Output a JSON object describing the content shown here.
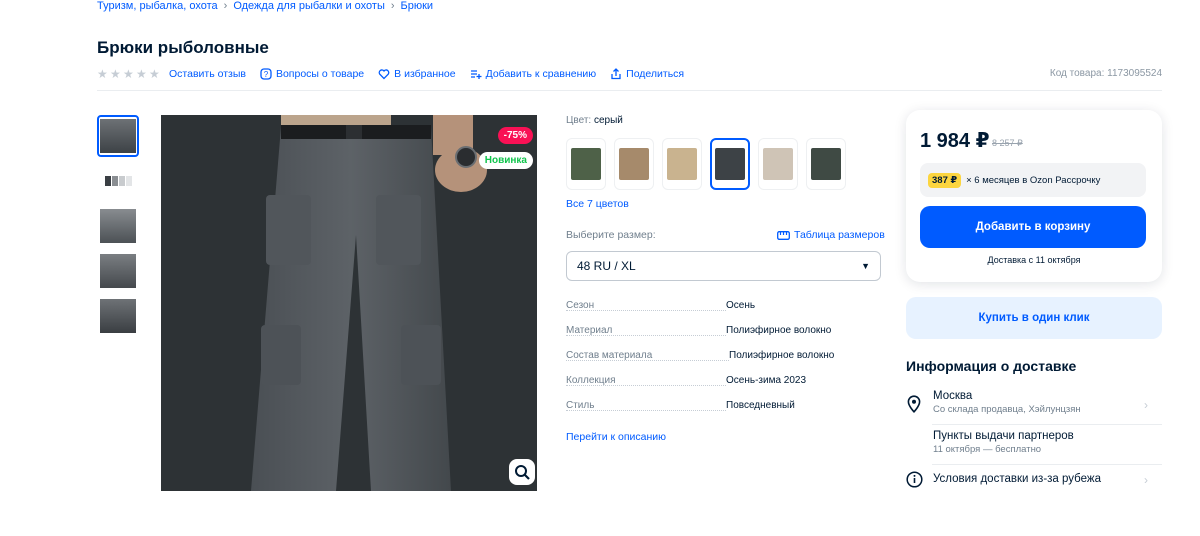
{
  "breadcrumb": [
    "Туризм, рыбалка, охота",
    "Одежда для рыбалки и охоты",
    "Брюки"
  ],
  "title": "Брюки рыболовные",
  "actions": {
    "review": "Оставить отзыв",
    "questions": "Вопросы о товаре",
    "favorite": "В избранное",
    "compare": "Добавить к сравнению",
    "share": "Поделиться"
  },
  "product_code": "Код товара: 1173095524",
  "badges": {
    "discount": "-75%",
    "new": "Новинка"
  },
  "color": {
    "label": "Цвет:",
    "value": "серый",
    "all_colors": "Все 7 цветов"
  },
  "size": {
    "label": "Выберите размер:",
    "table_link": "Таблица размеров",
    "selected": "48 RU / XL"
  },
  "properties": [
    {
      "key": "Сезон",
      "value": "Осень"
    },
    {
      "key": "Материал",
      "value": "Полиэфирное волокно"
    },
    {
      "key": "Состав материала",
      "value": "Полиэфирное волокно"
    },
    {
      "key": "Коллекция",
      "value": "Осень-зима 2023"
    },
    {
      "key": "Стиль",
      "value": "Повседневный"
    }
  ],
  "to_description": "Перейти к описанию",
  "price": {
    "current": "1 984 ₽",
    "old": "8 257 ₽",
    "installment_amount": "387 ₽",
    "installment_text": "× 6 месяцев в Ozon Рассрочку",
    "add_to_cart": "Добавить в корзину",
    "delivery": "Доставка с 11 октября"
  },
  "buy_one_click": "Купить в один клик",
  "delivery_info": {
    "heading": "Информация о доставке",
    "city": "Москва",
    "city_sub": "Со склада продавца, Хэйлунцзян",
    "pickup": "Пункты выдачи партнеров",
    "pickup_sub": "11 октября — бесплатно",
    "abroad": "Условия доставки из-за рубежа"
  },
  "colors": {
    "accent": "#005bff",
    "discount": "#f91155",
    "new": "#10c44c",
    "installment": "#fcd53f"
  }
}
